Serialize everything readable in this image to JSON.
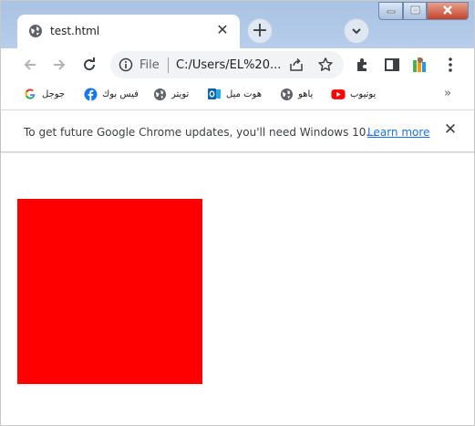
{
  "tab": {
    "title": "test.html",
    "close": "✕"
  },
  "newtab": {
    "label": "+"
  },
  "window_controls": {
    "min": "▁",
    "max": "▢",
    "close": "✕"
  },
  "omnibox": {
    "scheme": "File",
    "url": "C:/Users/EL%20..."
  },
  "bookmarks": {
    "items": [
      {
        "label": "جوجل",
        "icon": "google-icon"
      },
      {
        "label": "فيس بوك",
        "icon": "facebook-icon"
      },
      {
        "label": "تويتر",
        "icon": "globe-icon"
      },
      {
        "label": "هوت ميل",
        "icon": "outlook-icon"
      },
      {
        "label": "ياهو",
        "icon": "globe-icon"
      },
      {
        "label": "يوتيوب",
        "icon": "youtube-icon"
      }
    ],
    "more": "»"
  },
  "infobar": {
    "message": "To get future Google Chrome updates, you'll need Windows 10...",
    "link": "Learn more",
    "close": "✕"
  },
  "content": {
    "box_color": "#ff0000"
  }
}
